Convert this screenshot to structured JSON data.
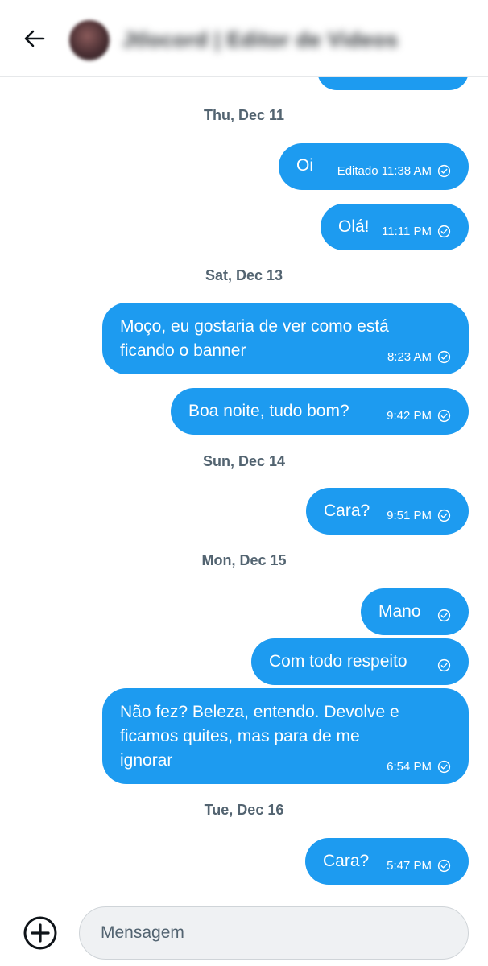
{
  "header": {
    "back_icon": "arrow-left-icon",
    "contact_name": "Jtlocord | Editor de Videos"
  },
  "conversation": {
    "days": [
      {
        "date": "Thu, Dec 11",
        "messages": [
          {
            "text": "Oi",
            "time": "Editado 11:38 AM",
            "status": "sent-check"
          },
          {
            "text": "Olá!",
            "time": "11:11 PM",
            "status": "sent-check"
          }
        ]
      },
      {
        "date": "Sat, Dec 13",
        "messages": [
          {
            "text_lines": [
              "Moço, eu gostaria de ver como está",
              "ficando o banner"
            ],
            "time": "8:23 AM",
            "status": "sent-check"
          },
          {
            "text": "Boa noite, tudo bom?",
            "time": "9:42 PM",
            "status": "sent-check"
          }
        ]
      },
      {
        "date": "Sun, Dec 14",
        "messages": [
          {
            "text": "Cara?",
            "time": "9:51 PM",
            "status": "sent-check"
          }
        ]
      },
      {
        "date": "Mon, Dec 15",
        "messages": [
          {
            "text": "Mano",
            "time": "",
            "status": "sent-check"
          },
          {
            "text": "Com todo respeito",
            "time": "",
            "status": "sent-check"
          },
          {
            "text_lines": [
              "Não fez? Beleza, entendo. Devolve e",
              "ficamos quites, mas para de me",
              "ignorar"
            ],
            "time": "6:54 PM",
            "status": "sent-check"
          }
        ]
      },
      {
        "date": "Tue, Dec 16",
        "messages": [
          {
            "text": "Cara?",
            "time": "5:47 PM",
            "status": "sent-check"
          }
        ]
      }
    ]
  },
  "composer": {
    "plus_icon": "plus-circle-icon",
    "placeholder": "Mensagem"
  },
  "colors": {
    "bubble": "#1d9bf0",
    "date_text": "#536471",
    "input_bg": "#eff1f3"
  }
}
